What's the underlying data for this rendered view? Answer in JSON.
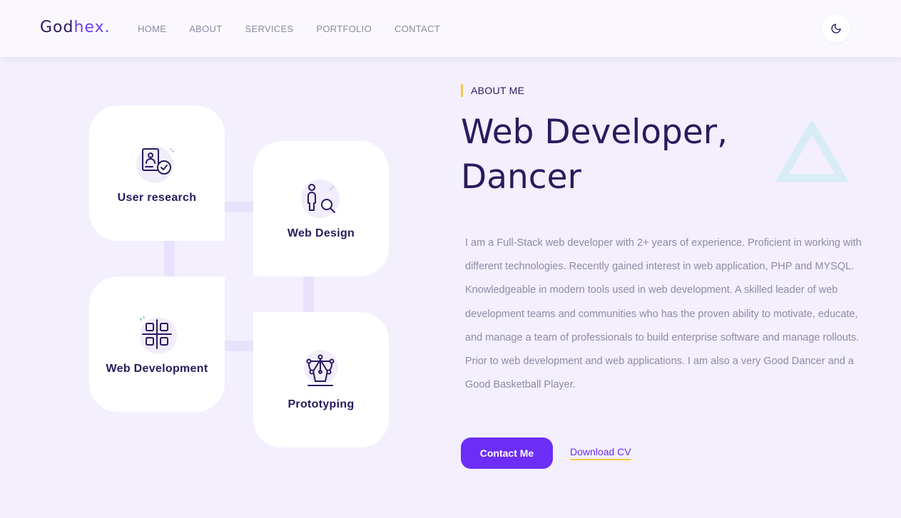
{
  "header": {
    "logo_main": "God",
    "logo_accent": "hex.",
    "nav": [
      "HOME",
      "ABOUT",
      "SERVICES",
      "PORTFOLIO",
      "CONTACT"
    ]
  },
  "services": [
    {
      "label": "User research",
      "icon": "user-research-icon"
    },
    {
      "label": "Web Design",
      "icon": "person-search-icon"
    },
    {
      "label": "Web Development",
      "icon": "grid-apps-icon"
    },
    {
      "label": "Prototyping",
      "icon": "pen-tool-icon"
    }
  ],
  "about": {
    "tag": "ABOUT ME",
    "heading_line1": "Web Developer,",
    "heading_line2": "Dancer",
    "description": "I am a Full-Stack web developer with 2+ years of experience. Proficient in working with different technologies. Recently gained interest in web application, PHP and MYSQL. Knowledgeable in modern tools used in web development. A skilled leader of web development teams and communities who has the proven ability to motivate, educate, and manage a team of professionals to build enterprise software and manage rollouts. Prior to web development and web applications. I am also a very Good Dancer and a Good Basketball Player.",
    "contact_button": "Contact Me",
    "download_link": "Download CV"
  },
  "colors": {
    "primary": "#6c2ef7",
    "dark": "#2a1a5e",
    "accent_yellow": "#f7c948",
    "background": "#f3effd",
    "triangle": "#d8ecf5"
  }
}
